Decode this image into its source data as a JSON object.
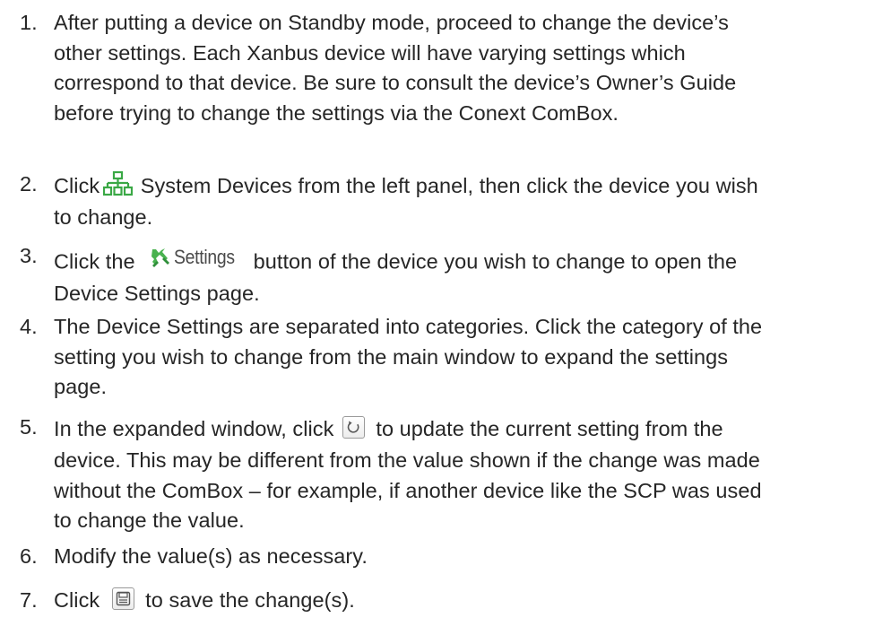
{
  "steps": [
    {
      "number": "1.",
      "lines": [
        "After putting a device on Standby mode, proceed to change the device’s",
        "other settings. Each Xanbus device will have varying settings which",
        "correspond to that device. Be sure to consult the device’s Owner’s Guide",
        "before trying to change the settings via the Conext ComBox."
      ]
    },
    {
      "number": "2.",
      "before_icon": "Click",
      "icon": "system-devices-icon",
      "after_icon": "System Devices from the left panel, then click the device you wish",
      "lines": [
        "to change."
      ]
    },
    {
      "number": "3.",
      "before_icon": "Click the",
      "button_label": "Settings",
      "icon": "settings-wrench-icon",
      "after_icon": "button of the device you wish to change to open the",
      "lines": [
        "Device Settings page."
      ]
    },
    {
      "number": "4.",
      "lines": [
        "The Device Settings are separated into categories. Click the category of the",
        "setting you wish to change from the main window to expand the settings",
        "page."
      ]
    },
    {
      "number": "5.",
      "before_icon": "In the expanded window, click",
      "icon": "refresh-icon",
      "after_icon": "to update the current setting from the",
      "lines": [
        "device. This may be different from the value shown if the change was made",
        "without the ComBox – for example, if another device like the SCP was used",
        "to change the value."
      ]
    },
    {
      "number": "6.",
      "lines": [
        "Modify the value(s) as necessary."
      ]
    },
    {
      "number": "7.",
      "before_icon": "Click",
      "icon": "save-icon",
      "after_icon": "to save the change(s)."
    }
  ],
  "colors": {
    "text": "#262626",
    "icon_green": "#3aa845",
    "button_border": "#9a9a9a"
  }
}
